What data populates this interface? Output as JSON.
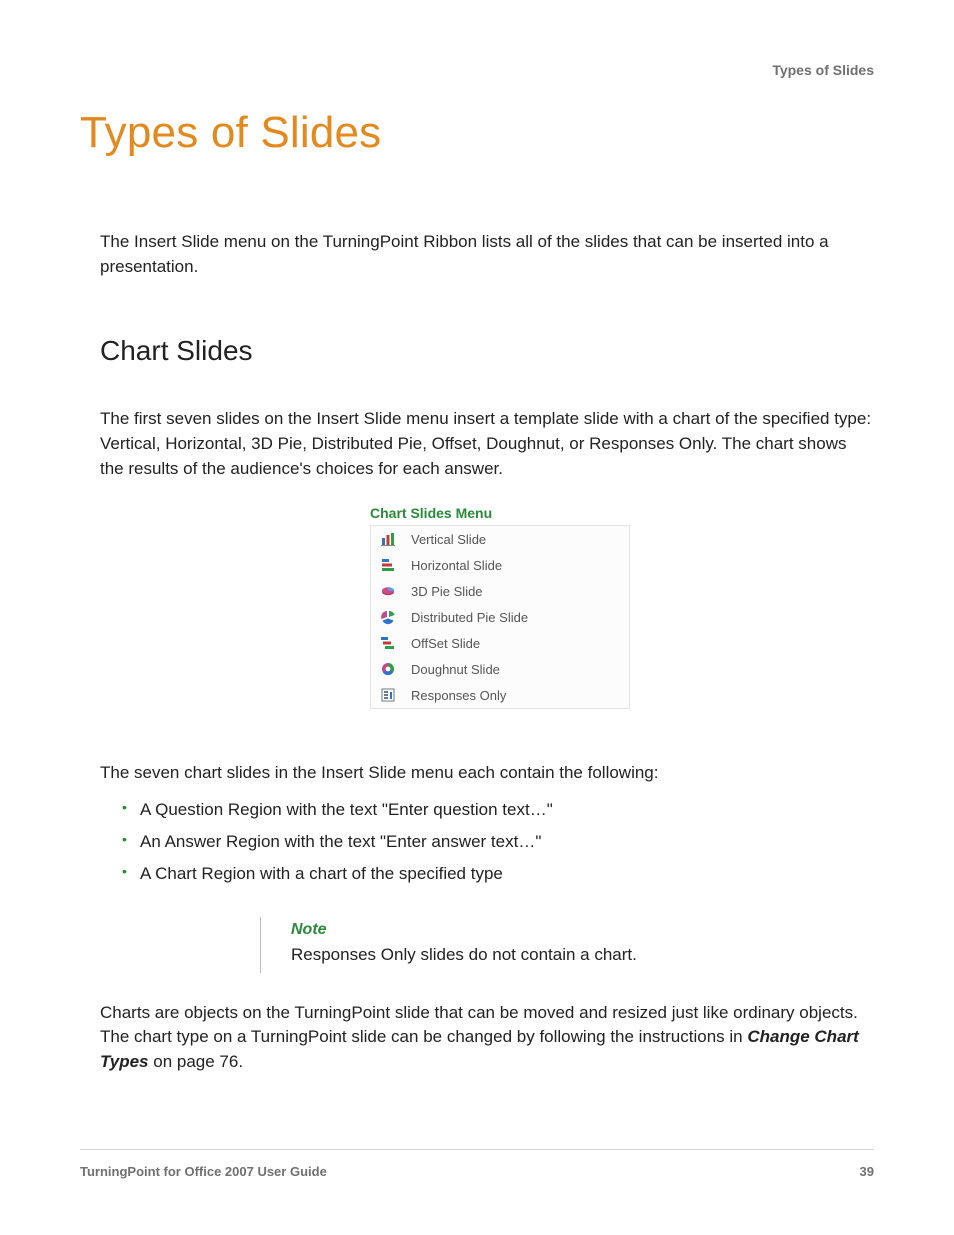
{
  "runningHead": "Types of Slides",
  "title": "Types of Slides",
  "intro": "The Insert Slide menu on the TurningPoint Ribbon lists all of the slides that can be inserted into a presentation.",
  "section": {
    "heading": "Chart Slides",
    "p1": "The first seven slides on the Insert Slide menu insert a template slide with a chart of the specified type: Vertical, Horizontal, 3D Pie, Distributed Pie, Offset, Doughnut, or Responses Only. The chart shows the results of the audience's choices for each answer.",
    "figureCaption": "Chart Slides Menu",
    "menu": [
      {
        "label": "Vertical Slide",
        "icon": "vertical-bar-icon"
      },
      {
        "label": "Horizontal Slide",
        "icon": "horizontal-bar-icon"
      },
      {
        "label": "3D Pie Slide",
        "icon": "pie-3d-icon"
      },
      {
        "label": "Distributed Pie Slide",
        "icon": "distributed-pie-icon"
      },
      {
        "label": "OffSet Slide",
        "icon": "offset-bar-icon"
      },
      {
        "label": "Doughnut Slide",
        "icon": "doughnut-icon"
      },
      {
        "label": "Responses Only",
        "icon": "responses-only-icon"
      }
    ],
    "p2": "The seven chart slides in the Insert Slide menu each contain the following:",
    "bullets": [
      "A Question Region with the text \"Enter question text…\"",
      "An Answer Region with the text \"Enter answer text…\"",
      "A Chart Region with a chart of the specified type"
    ],
    "note": {
      "label": "Note",
      "text": "Responses Only slides do not contain a chart."
    },
    "p3a": "Charts are objects on the TurningPoint slide that can be moved and resized just like ordinary objects. The chart type on a TurningPoint slide can be changed by following the instructions in ",
    "p3xref": "Change Chart Types",
    "p3b": " on page 76."
  },
  "footer": {
    "left": "TurningPoint for Office 2007 User Guide",
    "right": "39"
  }
}
